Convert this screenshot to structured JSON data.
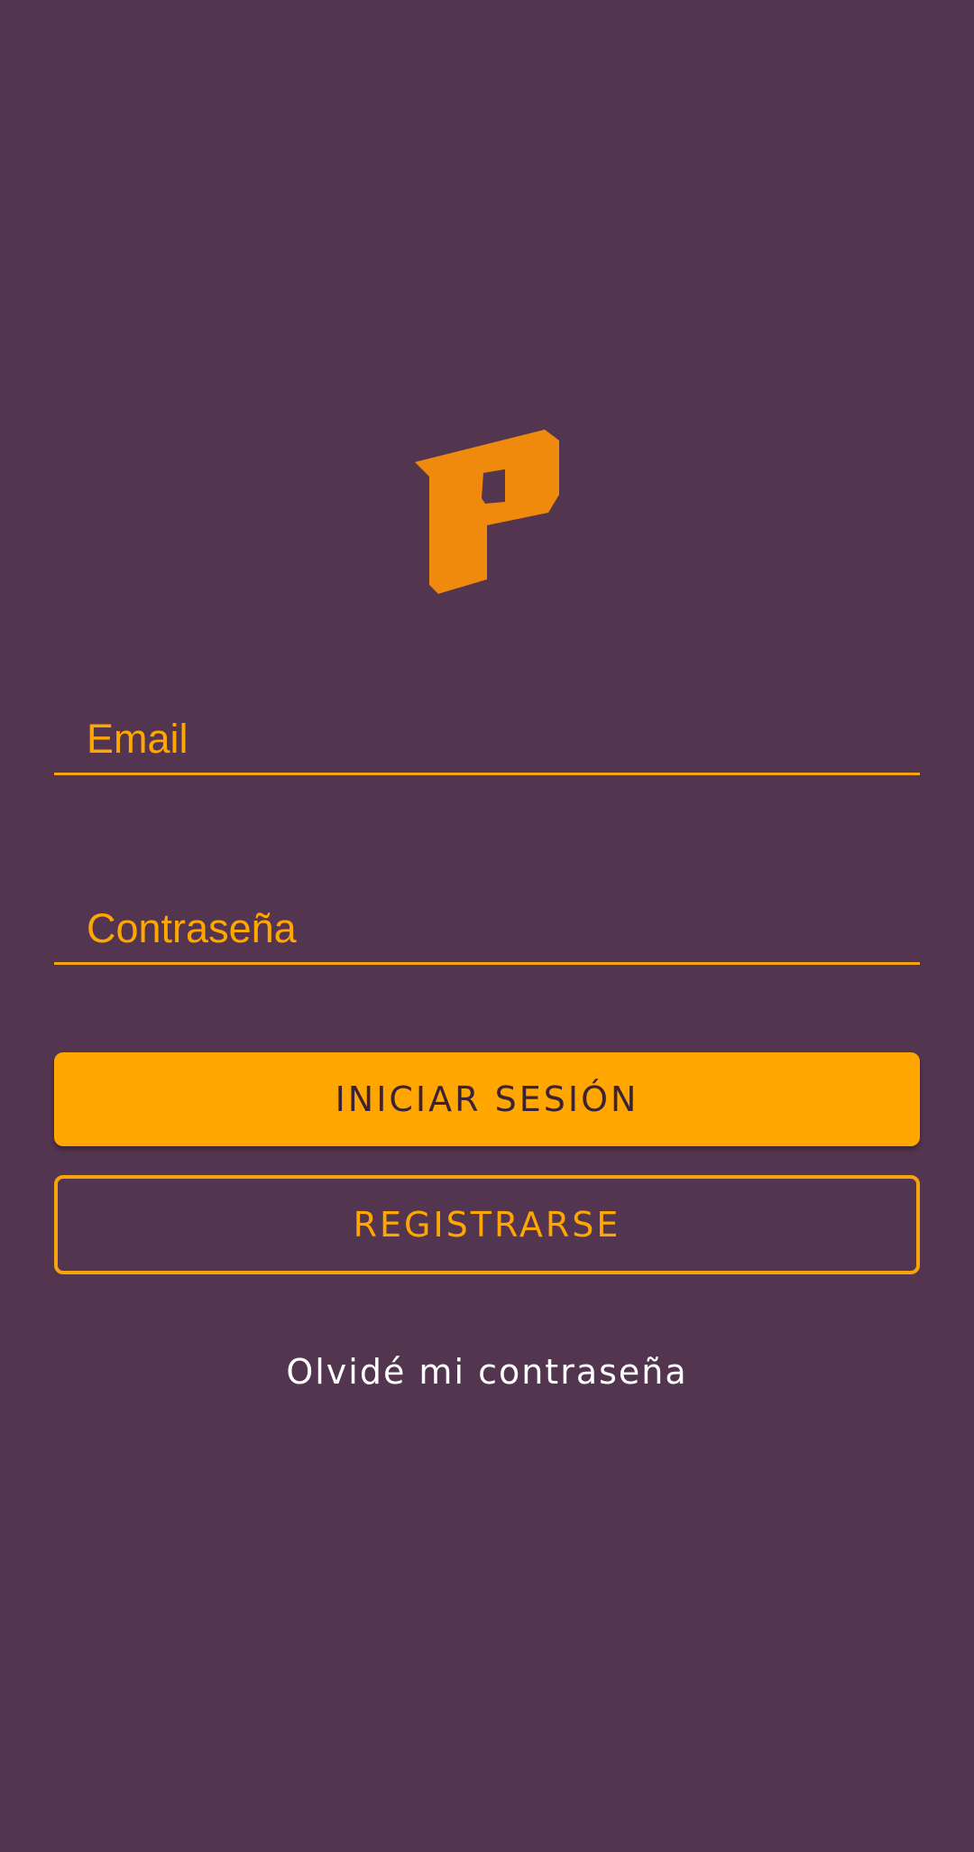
{
  "logo": {
    "icon": "p-logo-icon",
    "color": "#f08a0c"
  },
  "login_form": {
    "email": {
      "placeholder": "Email",
      "value": ""
    },
    "password": {
      "placeholder": "Contraseña",
      "value": ""
    },
    "login_button_label": "INICIAR SESIÓN",
    "register_button_label": "REGISTRARSE",
    "forgot_password_label": "Olvidé mi contraseña"
  },
  "colors": {
    "background": "#54354f",
    "accent": "#ffa600",
    "link_text": "#ffffff"
  }
}
